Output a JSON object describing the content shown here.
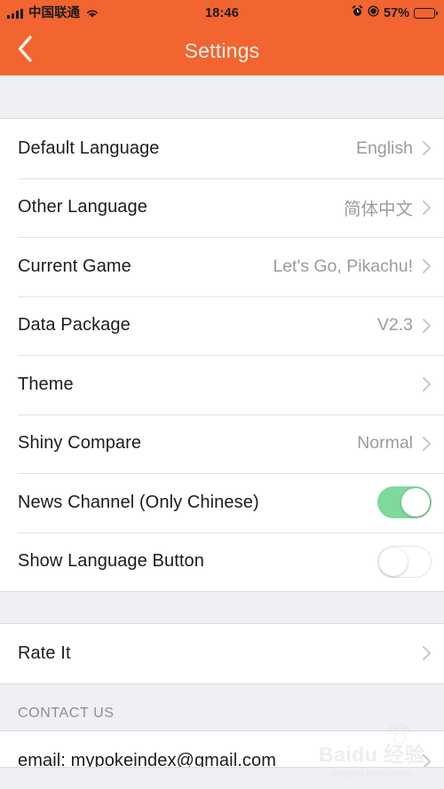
{
  "statusbar": {
    "carrier": "中国联通",
    "time": "18:46",
    "battery_percent": "57%",
    "icons": [
      "signal-bars-icon",
      "wifi-icon",
      "alarm-clock-icon",
      "rotation-lock-icon",
      "battery-icon"
    ],
    "battery_level": 57
  },
  "header": {
    "title": "Settings",
    "back_icon": "chevron-left-icon",
    "background_color": "#f26430",
    "title_color": "#fdf0e9"
  },
  "settings": {
    "rows": [
      {
        "label": "Default Language",
        "value": "English",
        "type": "disclosure"
      },
      {
        "label": "Other Language",
        "value": "简体中文",
        "type": "disclosure"
      },
      {
        "label": "Current Game",
        "value": "Let's Go, Pikachu!",
        "type": "disclosure"
      },
      {
        "label": "Data Package",
        "value": "V2.3",
        "type": "disclosure"
      },
      {
        "label": "Theme",
        "value": "",
        "type": "disclosure"
      },
      {
        "label": "Shiny Compare",
        "value": "Normal",
        "type": "disclosure"
      },
      {
        "label": "News Channel (Only Chinese)",
        "value": "",
        "type": "toggle",
        "toggle_on": true
      },
      {
        "label": "Show Language Button",
        "value": "",
        "type": "toggle",
        "toggle_on": false
      }
    ]
  },
  "rate": {
    "rows": [
      {
        "label": "Rate It",
        "value": "",
        "type": "disclosure"
      }
    ]
  },
  "contact": {
    "section_title": "CONTACT US",
    "rows": [
      {
        "label": "email: mypokeindex@gmail.com",
        "value": "",
        "type": "disclosure"
      }
    ]
  },
  "watermark": {
    "main": "Baidu 经验",
    "sub": "jingyan.baidu.com"
  },
  "colors": {
    "accent_orange": "#f26430",
    "toggle_on_green": "#7fd89c",
    "value_gray": "#9b9b9b",
    "page_background": "#efeff4"
  }
}
